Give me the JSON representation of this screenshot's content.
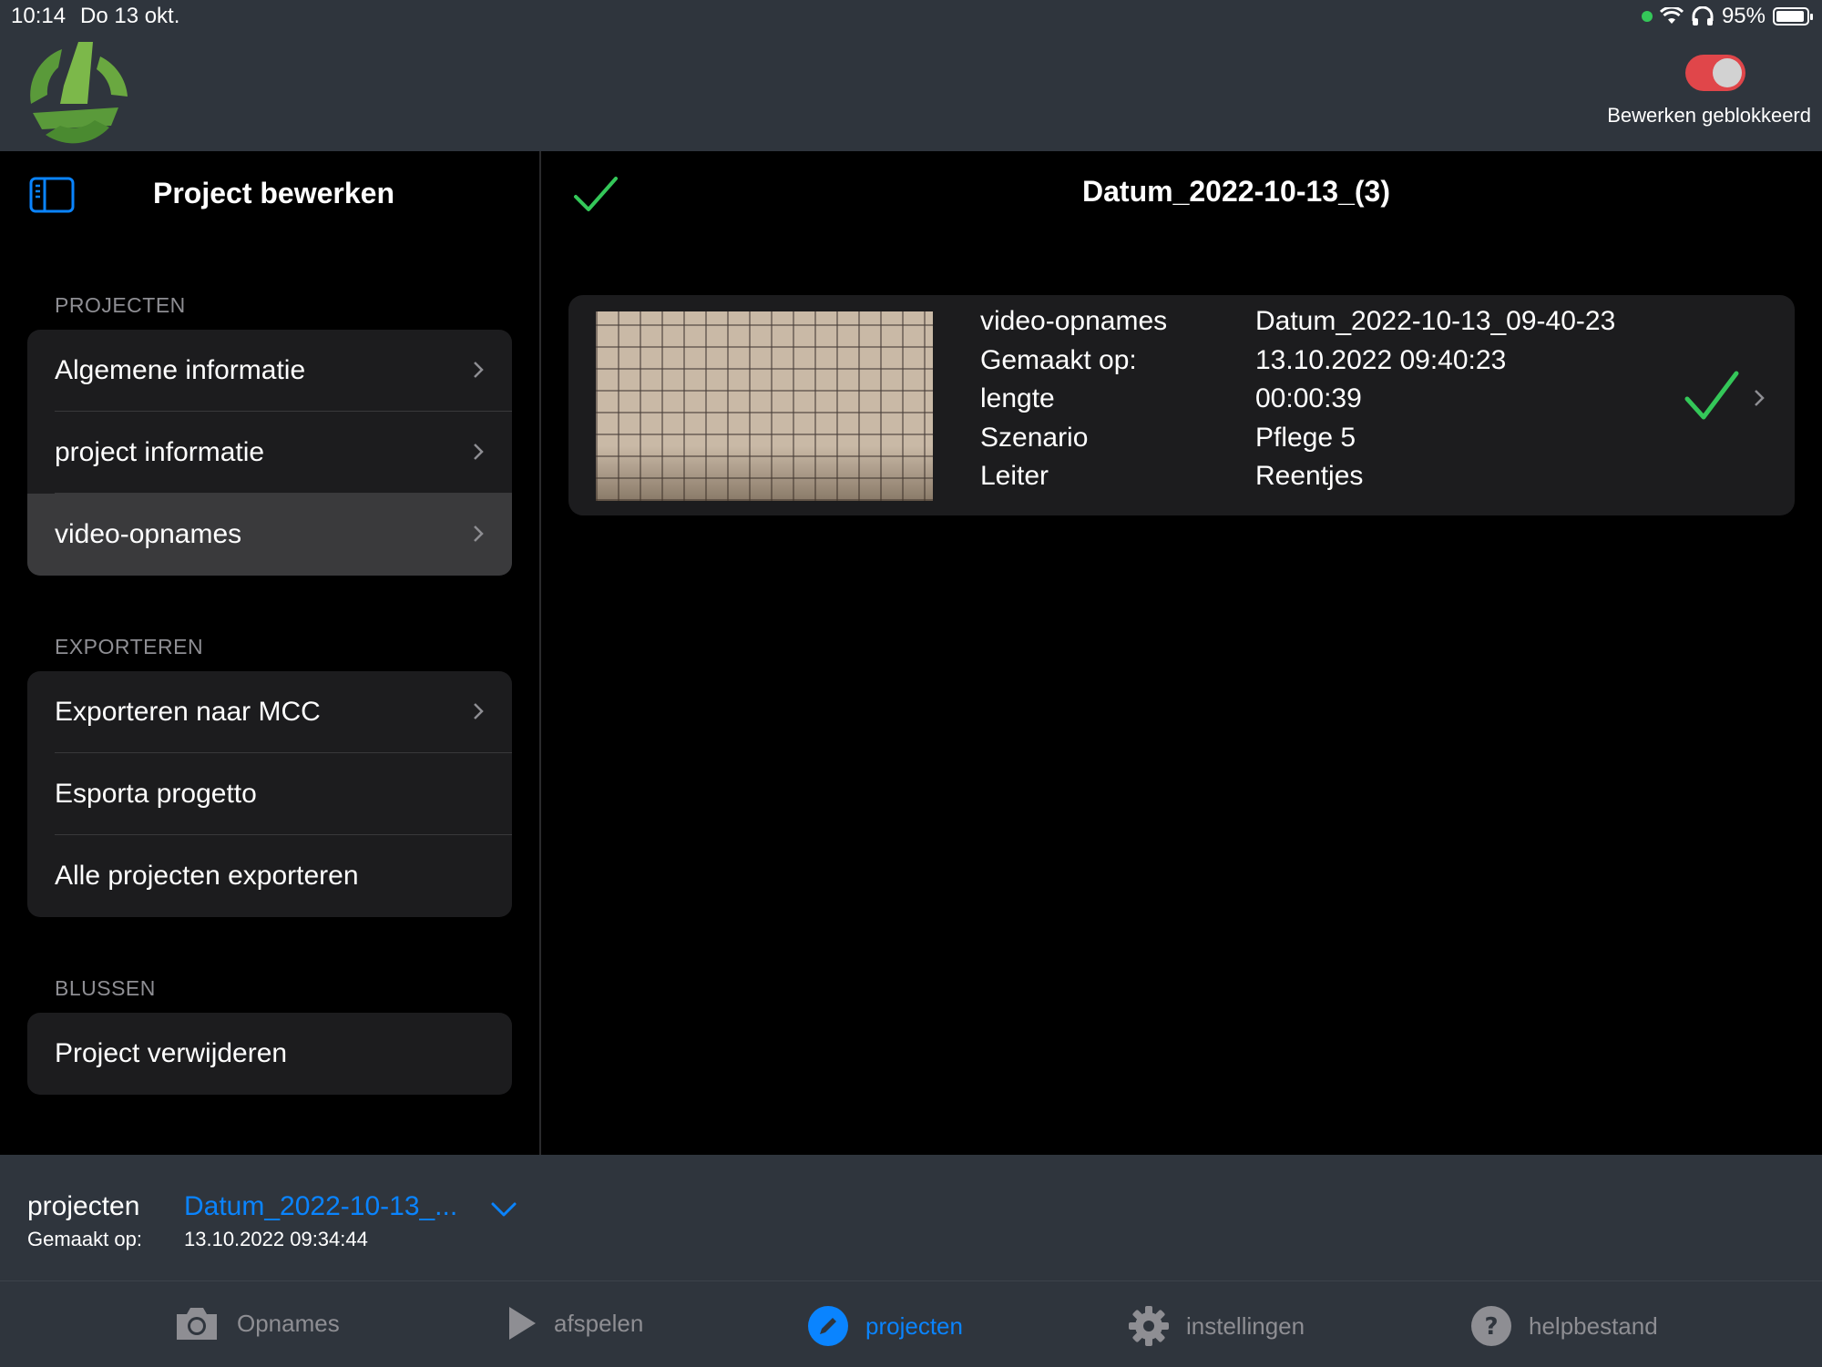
{
  "status_bar": {
    "time": "10:14",
    "date": "Do 13 okt.",
    "battery": "95%"
  },
  "header": {
    "toggle_label": "Bewerken geblokkeerd",
    "toggle_on": true
  },
  "sidebar": {
    "title": "Project bewerken",
    "sections": [
      {
        "header": "PROJECTEN",
        "items": [
          {
            "label": "Algemene informatie",
            "chevron": true
          },
          {
            "label": "project informatie",
            "chevron": true
          },
          {
            "label": "video-opnames",
            "chevron": true,
            "selected": true
          }
        ]
      },
      {
        "header": "EXPORTEREN",
        "items": [
          {
            "label": "Exporteren naar MCC",
            "chevron": true
          },
          {
            "label": "Esporta progetto",
            "chevron": false
          },
          {
            "label": "Alle projecten exporteren",
            "chevron": false
          }
        ]
      },
      {
        "header": "BLUSSEN",
        "items": [
          {
            "label": "Project verwijderen",
            "chevron": false
          }
        ]
      }
    ]
  },
  "detail": {
    "title": "Datum_2022-10-13_(3)",
    "recording": {
      "rows": [
        {
          "label": "video-opnames",
          "value": "Datum_2022-10-13_09-40-23"
        },
        {
          "label": "Gemaakt op:",
          "value": "13.10.2022 09:40:23"
        },
        {
          "label": "lengte",
          "value": "00:00:39"
        },
        {
          "label": "Szenario",
          "value": "Pflege 5"
        },
        {
          "label": "Leiter",
          "value": "Reentjes"
        }
      ]
    }
  },
  "project_bar": {
    "label": "projecten",
    "name": "Datum_2022-10-13_...",
    "created_label": "Gemaakt op:",
    "created_value": "13.10.2022 09:34:44"
  },
  "tabs": [
    {
      "label": "Opnames",
      "icon": "camera-icon",
      "active": false
    },
    {
      "label": "afspelen",
      "icon": "play-icon",
      "active": false
    },
    {
      "label": "projecten",
      "icon": "pencil-icon",
      "active": true
    },
    {
      "label": "instellingen",
      "icon": "gear-icon",
      "active": false
    },
    {
      "label": "helpbestand",
      "icon": "help-icon",
      "active": false
    }
  ],
  "colors": {
    "accent": "#0a84ff",
    "check": "#34c759",
    "toggle": "#e0464a",
    "bar": "#2f353d",
    "logo": "#5a9a3a"
  }
}
